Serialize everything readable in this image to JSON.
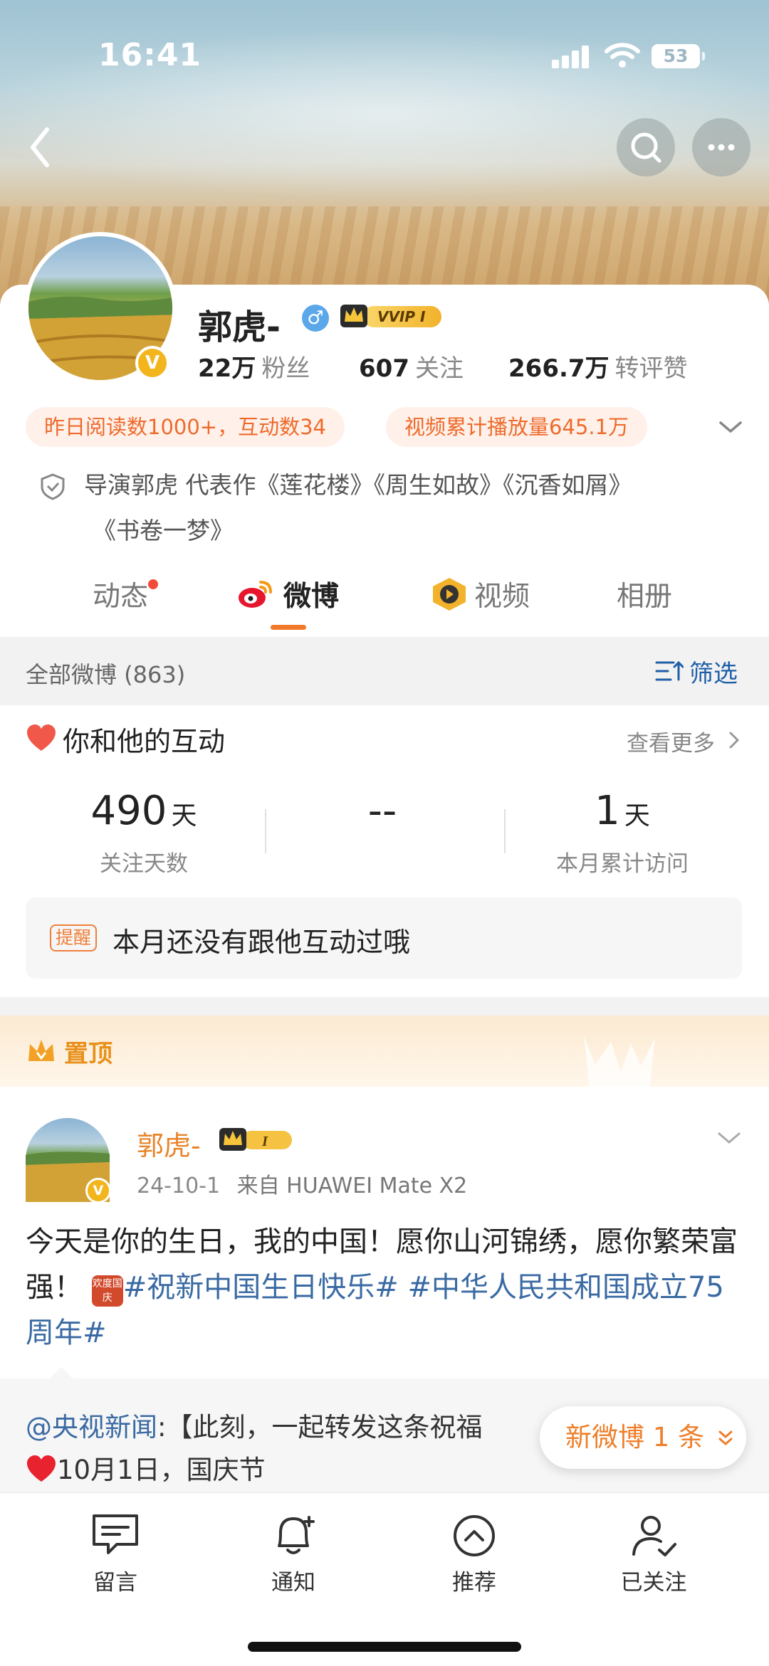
{
  "status_bar": {
    "time": "16:41",
    "battery": "53"
  },
  "profile": {
    "name": "郭虎-",
    "vip_label": "VVIP I",
    "avatar_badge": "V",
    "stats": [
      {
        "num": "22万",
        "label": "粉丝"
      },
      {
        "num": "607",
        "label": "关注"
      },
      {
        "num": "266.7万",
        "label": "转评赞"
      }
    ],
    "pills": [
      "昨日阅读数1000+，互动数34",
      "视频累计播放量645.1万"
    ],
    "bio_line1": "导演郭虎 代表作《莲花楼》《周生如故》《沉香如屑》",
    "bio_line2": "《书卷一梦》"
  },
  "tabs": [
    {
      "label": "动态"
    },
    {
      "label": "微博"
    },
    {
      "label": "视频"
    },
    {
      "label": "相册"
    }
  ],
  "filter_bar": {
    "all_label": "全部微博 (863)",
    "filter_label": "筛选"
  },
  "interaction": {
    "title": "你和他的互动",
    "more_label": "查看更多",
    "stats": [
      {
        "value": "490",
        "unit": "天",
        "label": "关注天数"
      },
      {
        "value": "--",
        "unit": "",
        "label": ""
      },
      {
        "value": "1",
        "unit": "天",
        "label": "本月累计访问"
      }
    ],
    "remind_badge": "提醒",
    "remind_text": "本月还没有跟他互动过哦"
  },
  "pinned": {
    "label": "置顶",
    "author": "郭虎-",
    "date": "24-10-1",
    "source": "来自 HUAWEI Mate X2",
    "text_plain": "今天是你的生日，我的中国！愿你山河锦绣，愿你繁荣富强！",
    "emoji_label": "欢度国庆",
    "hashtag1": "#祝新中国生日快乐#",
    "hashtag2": "#中华人民共和国成立75周年#"
  },
  "repost": {
    "at_user": "@央视新闻",
    "line1_rest": ":【此刻，一起转发这条祝福",
    "line2": "10月1日，国庆节"
  },
  "new_posts_pill": "新微博 1 条",
  "bottom_bar": [
    "留言",
    "通知",
    "推荐",
    "已关注"
  ],
  "colors": {
    "accent": "#ef7f2a",
    "link": "#3a6aa3",
    "vip_gold": "#f2b22b"
  }
}
